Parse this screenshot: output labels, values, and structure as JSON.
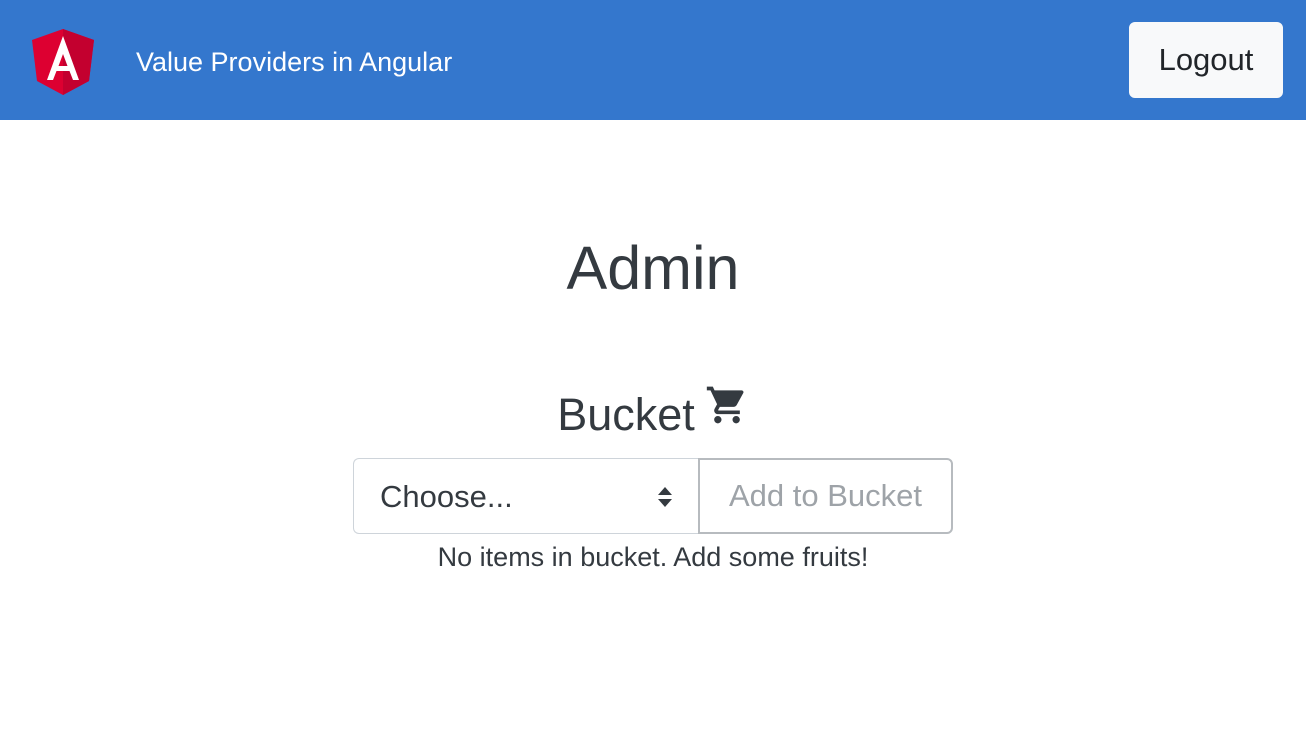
{
  "navbar": {
    "title": "Value Providers in Angular",
    "logo_icon": "angular-logo-icon",
    "logout_label": "Logout",
    "background_color": "#3477cd"
  },
  "main": {
    "title": "Admin",
    "bucket": {
      "heading": "Bucket",
      "heading_icon": "shopping-cart-icon",
      "select": {
        "selected_value": "Choose..."
      },
      "add_button_label": "Add to Bucket",
      "empty_message": "No items in bucket. Add some fruits!"
    }
  }
}
